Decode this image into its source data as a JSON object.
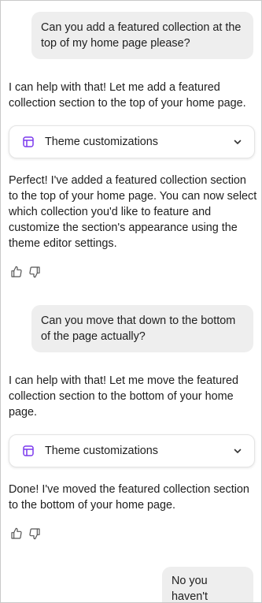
{
  "conversation": {
    "messages": [
      {
        "role": "user",
        "text": "Can you add a featured collection at the top of my  home page please?"
      },
      {
        "role": "assistant",
        "text": "I can help with that! Let me add a featured collection section to the top of your home page."
      },
      {
        "role": "tool",
        "label": "Theme customizations",
        "icon": "theme-icon"
      },
      {
        "role": "assistant",
        "text": "Perfect! I've added a featured collection section to the top of your home page. You can now select which collection you'd like to feature and customize the section's appearance using the theme editor settings."
      },
      {
        "role": "user",
        "text": "Can you move that down to the bottom of the page actually?"
      },
      {
        "role": "assistant",
        "text": "I can help with that! Let me move the featured collection section to the bottom of your home page."
      },
      {
        "role": "tool",
        "label": "Theme customizations",
        "icon": "theme-icon"
      },
      {
        "role": "assistant",
        "text": "Done! I've moved the featured collection section to the bottom of your home page."
      },
      {
        "role": "user",
        "text": "No you haven't"
      }
    ]
  },
  "colors": {
    "accent": "#7c3aed",
    "user_bubble": "#eeeeee",
    "text": "#202020",
    "icon": "#555555"
  },
  "icons": [
    "theme-icon",
    "chevron-down-icon",
    "thumbs-up-icon",
    "thumbs-down-icon"
  ]
}
